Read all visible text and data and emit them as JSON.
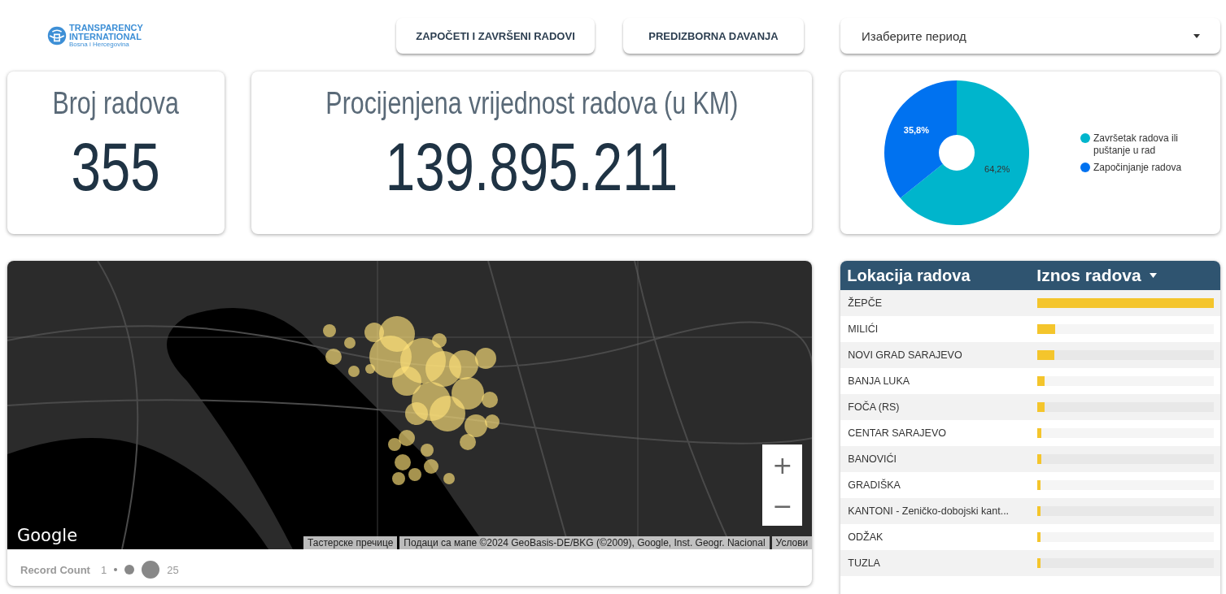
{
  "logo": {
    "lines": [
      "TRANSPARENCY",
      "INTERNATIONAL",
      "Bosna i Hercegovina"
    ]
  },
  "nav_buttons": [
    "ZAPOČETI I ZAVRŠENI RADOVI",
    "PREDIZBORNA DAVANJA"
  ],
  "period_select": {
    "placeholder": "Изаберите период"
  },
  "kpis": [
    {
      "label": "Broj radova",
      "value": "355"
    },
    {
      "label": "Procijenjena vrijednost radova (u KM)",
      "value": "139.895.211"
    }
  ],
  "pie": {
    "chart_data": {
      "type": "donut",
      "categories": [
        "Završetak radova ili puštanje u rad",
        "Započinjanje radova"
      ],
      "values": [
        64.2,
        35.8
      ],
      "colors": [
        "#00b5cc",
        "#0072f0"
      ],
      "value_labels": [
        "64,2%",
        "35,8%"
      ]
    }
  },
  "map": {
    "zoom_in": "+",
    "zoom_out": "−",
    "brand": "Google",
    "attribution": [
      "Тастерске пречице",
      "Подаци са мапе ©2024 GeoBasis-DE/BKG (©2009), Google, Inst. Geogr. Nacional",
      "Услови"
    ],
    "legend": {
      "title": "Record Count",
      "min": "1",
      "max": "25"
    }
  },
  "table": {
    "columns": [
      {
        "label": "Lokacija radova",
        "sorted": false
      },
      {
        "label": "Iznos radova",
        "sorted": true
      }
    ],
    "rows": [
      {
        "location": "ŽEPČE",
        "level": 1.0
      },
      {
        "location": "MILIĆI",
        "level": 0.1
      },
      {
        "location": "NOVI GRAD SARAJEVO",
        "level": 0.097
      },
      {
        "location": "BANJA LUKA",
        "level": 0.043
      },
      {
        "location": "FOČA (RS)",
        "level": 0.043
      },
      {
        "location": "CENTAR SARAJEVO",
        "level": 0.022
      },
      {
        "location": "BANOVIĆI",
        "level": 0.022
      },
      {
        "location": "GRADIŠKA",
        "level": 0.018
      },
      {
        "location": "KANTONI - Zeničko-dobojski kant...",
        "level": 0.018
      },
      {
        "location": "ODŽAK",
        "level": 0.018
      },
      {
        "location": "TUZLA",
        "level": 0.018
      }
    ]
  }
}
